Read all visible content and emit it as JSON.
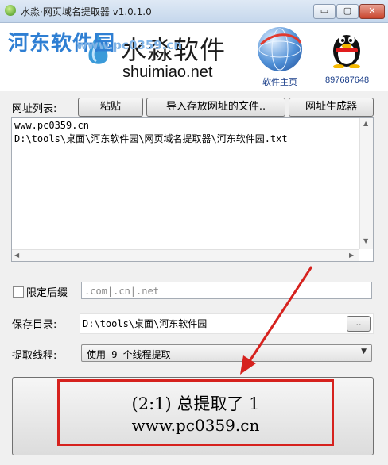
{
  "window": {
    "title": "水淼·网页域名提取器 v1.0.1.0",
    "controls": {
      "minimize": "▭",
      "maximize": "▢",
      "close": "✕"
    }
  },
  "banner": {
    "watermark_logo": "河东软件园",
    "watermark_url": "www.pc0359.cn",
    "brand_name": "水淼软件",
    "brand_url": "shuimiao.net",
    "home_label": "软件主页",
    "qq_label": "897687648"
  },
  "toolbar": {
    "url_list_label": "网址列表:",
    "paste_label": "粘贴",
    "import_label": "导入存放网址的文件..",
    "generator_label": "网址生成器"
  },
  "url_list": {
    "lines": [
      "www.pc0359.cn",
      "D:\\tools\\桌面\\河东软件园\\网页域名提取器\\河东软件园.txt"
    ]
  },
  "suffix": {
    "label": "限定后缀",
    "checked": false,
    "placeholder": ".com|.cn|.net"
  },
  "save": {
    "label": "保存目录:",
    "path": "D:\\tools\\桌面\\河东软件园",
    "browse_label": ".."
  },
  "threads": {
    "label": "提取线程:",
    "selected": "使用 9 个线程提取"
  },
  "status": {
    "line1": "(2:1) 总提取了 1",
    "line2": "www.pc0359.cn"
  },
  "colors": {
    "annotation_red": "#d6221e",
    "titlebar": "#c5d7ec",
    "watermark_blue": "#2f7fd3"
  }
}
